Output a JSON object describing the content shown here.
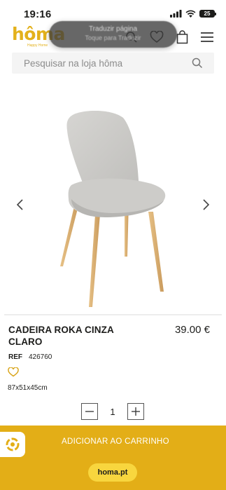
{
  "status_bar": {
    "time": "19:16",
    "battery": "25",
    "icons": [
      "cellular-signal-icon",
      "wifi-icon",
      "battery-icon"
    ]
  },
  "header": {
    "logo": "hôma",
    "logo_tagline": "Happy Home",
    "icons": [
      "search-icon",
      "wishlist-heart-icon",
      "shopping-bag-icon",
      "hamburger-menu-icon"
    ],
    "translate_popup": {
      "line1": "Traduzir página",
      "line2": "Toque para Traduzir"
    }
  },
  "search": {
    "placeholder": "Pesquisar na loja hôma"
  },
  "gallery": {
    "prev_icon": "chevron-left-icon",
    "next_icon": "chevron-right-icon"
  },
  "product": {
    "title": "CADEIRA ROKA CINZA CLARO",
    "price": "39.00 €",
    "ref_label": "REF",
    "ref_value": "426760",
    "dimensions": "87x51x45cm"
  },
  "quantity": {
    "value": "1"
  },
  "cart": {
    "add_label": "ADICIONAR AO CARRINHO"
  },
  "browser": {
    "url": "homa.pt"
  },
  "colors": {
    "brand_yellow": "#e3b11c",
    "cart_bar": "#e3ae17",
    "url_pill": "#f8d63e"
  }
}
